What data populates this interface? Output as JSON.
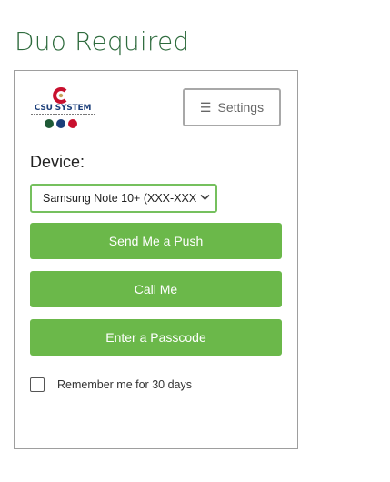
{
  "page": {
    "title": "Duo Required"
  },
  "logo": {
    "text": "CSU SYSTEM",
    "colors": {
      "primary": "#1c3f7a",
      "accent": "#c8102e",
      "gold": "#c8a15a"
    }
  },
  "settings": {
    "label": "Settings",
    "icon": "hamburger-icon"
  },
  "device": {
    "label": "Device:",
    "selected": "Samsung Note 10+ (XXX-XXX"
  },
  "actions": [
    {
      "label": "Send Me a Push"
    },
    {
      "label": "Call Me"
    },
    {
      "label": "Enter a Passcode"
    }
  ],
  "remember": {
    "label": "Remember me for 30 days",
    "checked": false
  },
  "colors": {
    "title_green": "#2e6b3d",
    "button_green": "#6bb84a",
    "select_border": "#75c05e"
  }
}
